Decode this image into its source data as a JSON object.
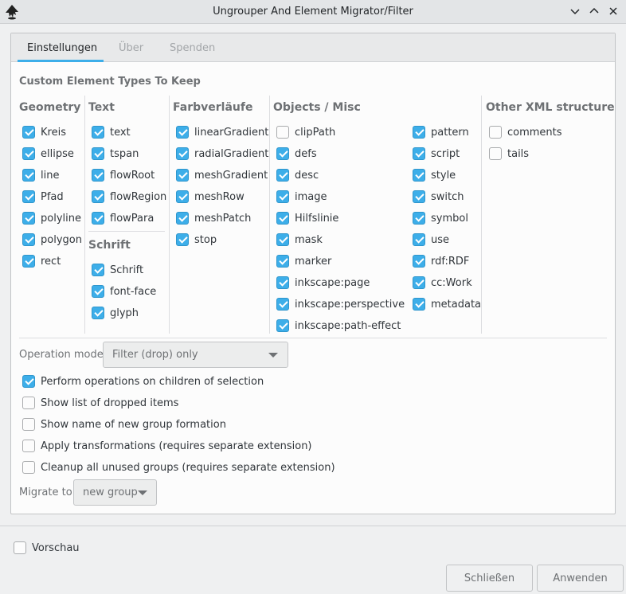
{
  "window": {
    "title": "Ungrouper And Element Migrator/Filter",
    "icon": "inkscape-logo-icon",
    "controls": [
      "chevron-down-icon",
      "chevron-up-icon",
      "close-icon"
    ]
  },
  "tabs": [
    {
      "label": "Einstellungen",
      "active": true
    },
    {
      "label": "Über",
      "active": false
    },
    {
      "label": "Spenden",
      "active": false
    }
  ],
  "section_title": "Custom Element Types To Keep",
  "columns": {
    "geometry": {
      "title": "Geometry",
      "items": [
        {
          "label": "Kreis",
          "checked": true
        },
        {
          "label": "ellipse",
          "checked": true
        },
        {
          "label": "line",
          "checked": true
        },
        {
          "label": "Pfad",
          "checked": true
        },
        {
          "label": "polyline",
          "checked": true
        },
        {
          "label": "polygon",
          "checked": true
        },
        {
          "label": "rect",
          "checked": true
        }
      ]
    },
    "text": {
      "title": "Text",
      "items": [
        {
          "label": "text",
          "checked": true
        },
        {
          "label": "tspan",
          "checked": true
        },
        {
          "label": "flowRoot",
          "checked": true
        },
        {
          "label": "flowRegion",
          "checked": true
        },
        {
          "label": "flowPara",
          "checked": true
        }
      ]
    },
    "schrift": {
      "title": "Schrift",
      "items": [
        {
          "label": "Schrift",
          "checked": true
        },
        {
          "label": "font-face",
          "checked": true
        },
        {
          "label": "glyph",
          "checked": true
        }
      ]
    },
    "gradients": {
      "title": "Farbverläufe",
      "items": [
        {
          "label": "linearGradient",
          "checked": true
        },
        {
          "label": "radialGradient",
          "checked": true
        },
        {
          "label": "meshGradient",
          "checked": true
        },
        {
          "label": "meshRow",
          "checked": true
        },
        {
          "label": "meshPatch",
          "checked": true
        },
        {
          "label": "stop",
          "checked": true
        }
      ]
    },
    "objects": {
      "title": "Objects / Misc",
      "items_left": [
        {
          "label": "clipPath",
          "checked": false
        },
        {
          "label": "defs",
          "checked": true
        },
        {
          "label": "desc",
          "checked": true
        },
        {
          "label": "image",
          "checked": true
        },
        {
          "label": "Hilfslinie",
          "checked": true
        },
        {
          "label": "mask",
          "checked": true
        },
        {
          "label": "marker",
          "checked": true
        },
        {
          "label": "inkscape:page",
          "checked": true
        },
        {
          "label": "inkscape:perspective",
          "checked": true
        },
        {
          "label": "inkscape:path-effect",
          "checked": true
        }
      ],
      "items_right": [
        {
          "label": "pattern",
          "checked": true
        },
        {
          "label": "script",
          "checked": true
        },
        {
          "label": "style",
          "checked": true
        },
        {
          "label": "switch",
          "checked": true
        },
        {
          "label": "symbol",
          "checked": true
        },
        {
          "label": "use",
          "checked": true
        },
        {
          "label": "rdf:RDF",
          "checked": true
        },
        {
          "label": "cc:Work",
          "checked": true
        },
        {
          "label": "metadata",
          "checked": true
        }
      ]
    },
    "xml": {
      "title": "Other XML structure",
      "items": [
        {
          "label": "comments",
          "checked": false
        },
        {
          "label": "tails",
          "checked": false
        }
      ]
    }
  },
  "operation_mode": {
    "label": "Operation mode",
    "value": "Filter (drop) only"
  },
  "options": [
    {
      "label": "Perform operations on children of selection",
      "checked": true
    },
    {
      "label": "Show list of dropped items",
      "checked": false
    },
    {
      "label": "Show name of new group formation",
      "checked": false
    },
    {
      "label": "Apply transformations (requires separate extension)",
      "checked": false
    },
    {
      "label": "Cleanup all unused groups (requires separate extension)",
      "checked": false
    }
  ],
  "migrate_to": {
    "label": "Migrate to",
    "value": "new group"
  },
  "preview": {
    "label": "Vorschau",
    "checked": false
  },
  "buttons": {
    "close": "Schließen",
    "apply": "Anwenden"
  },
  "colors": {
    "accent": "#3daee9",
    "background": "#eff0f1",
    "panel": "#fcfcfc"
  }
}
